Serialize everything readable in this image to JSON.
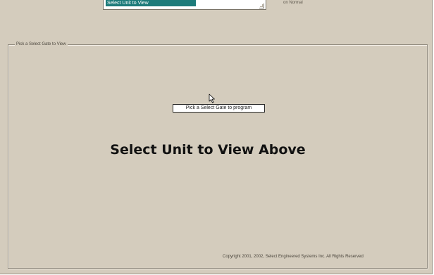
{
  "unit_select": {
    "selected_value": "Select Unit to View"
  },
  "top_status": "on Normal",
  "group": {
    "label": "Pick a Select Gate to View"
  },
  "program_button_label": "Pick a Select Gate to program",
  "main_heading": "Select Unit to View Above",
  "copyright": "Copyright 2001, 2002, Select Engineered Systems Inc. All Rights Reserved",
  "icons": {
    "cursor": "mouse-pointer-icon",
    "grip": "resize-grip-icon"
  },
  "colors": {
    "window_bg": "#d4ccbd",
    "selection": "#1d7b7a"
  }
}
